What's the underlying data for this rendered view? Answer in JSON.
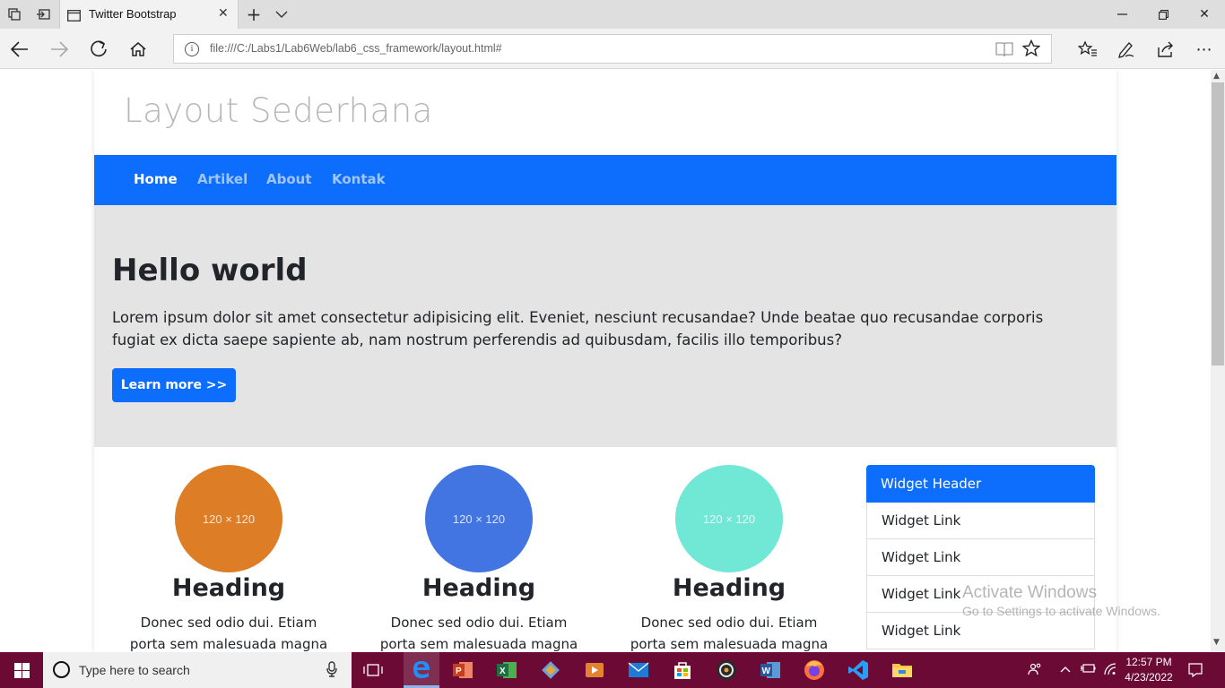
{
  "browser": {
    "tab_title": "Twitter Bootstrap",
    "url": "file:///C:/Labs1/Lab6Web/lab6_css_framework/layout.html#",
    "info_icon_glyph": "i"
  },
  "page": {
    "site_title": "Layout Sederhana",
    "nav": [
      {
        "label": "Home",
        "active": true
      },
      {
        "label": "Artikel",
        "active": false
      },
      {
        "label": "About",
        "active": false
      },
      {
        "label": "Kontak",
        "active": false
      }
    ],
    "jumbotron": {
      "title": "Hello world",
      "text": "Lorem ipsum dolor sit amet consectetur adipisicing elit. Eveniet, nesciunt recusandae? Unde beatae quo recusandae corporis fugiat ex dicta saepe sapiente ab, nam nostrum perferendis ad quibusdam, facilis illo temporibus?",
      "button": "Learn more >>"
    },
    "features": [
      {
        "placeholder": "120 × 120",
        "color": "#dd7d25",
        "heading": "Heading",
        "text": "Donec sed odio dui. Etiam porta sem malesuada magna mollis"
      },
      {
        "placeholder": "120 × 120",
        "color": "#4275e2",
        "heading": "Heading",
        "text": "Donec sed odio dui. Etiam porta sem malesuada magna mollis"
      },
      {
        "placeholder": "120 × 120",
        "color": "#71e7d5",
        "heading": "Heading",
        "text": "Donec sed odio dui. Etiam porta sem malesuada magna mollis"
      }
    ],
    "widget": {
      "header": "Widget Header",
      "links": [
        "Widget Link",
        "Widget Link",
        "Widget Link",
        "Widget Link"
      ]
    }
  },
  "watermark": {
    "line1": "Activate Windows",
    "line2": "Go to Settings to activate Windows."
  },
  "taskbar": {
    "search_placeholder": "Type here to search",
    "time": "12:57 PM",
    "date": "4/23/2022"
  },
  "colors": {
    "primary": "#0d6efd",
    "jumbotron_bg": "#e4e4e4",
    "taskbar_bg": "#6b0a35"
  }
}
